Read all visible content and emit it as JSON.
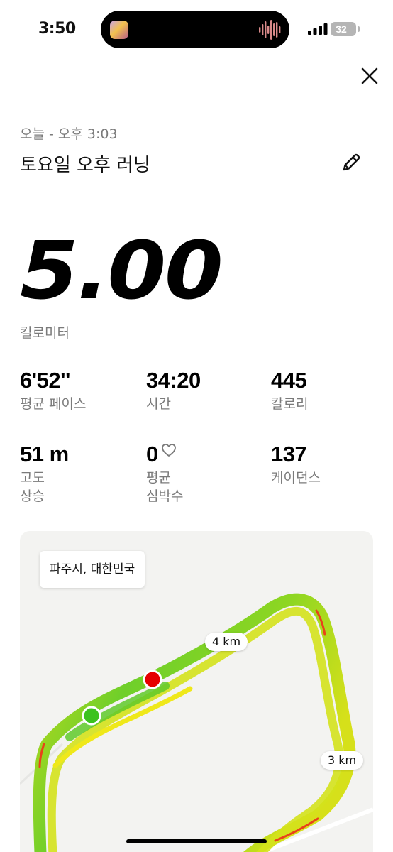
{
  "status_bar": {
    "time": "3:50",
    "battery": "32"
  },
  "header": {
    "subtitle": "오늘 - 오후 3:03",
    "title": "토요일 오후 러닝"
  },
  "distance": {
    "value": "5.00",
    "unit": "킬로미터"
  },
  "stats": [
    {
      "value": "6'52''",
      "label": "평균 페이스"
    },
    {
      "value": "34:20",
      "label": "시간"
    },
    {
      "value": "445",
      "label": "칼로리"
    },
    {
      "value": "51 m",
      "label_line1": "고도",
      "label_line2": "상승"
    },
    {
      "value": "0",
      "label_line1": "평균",
      "label_line2": "심박수"
    },
    {
      "value": "137",
      "label": "케이던스"
    }
  ],
  "map": {
    "location": "파주시, 대한민국",
    "km_markers": [
      "4 km",
      "3 km"
    ],
    "colors": {
      "route_green": "#7ed321",
      "route_yellow": "#e8e01a",
      "start_marker": "#3cc21f",
      "end_marker": "#e60000"
    }
  }
}
